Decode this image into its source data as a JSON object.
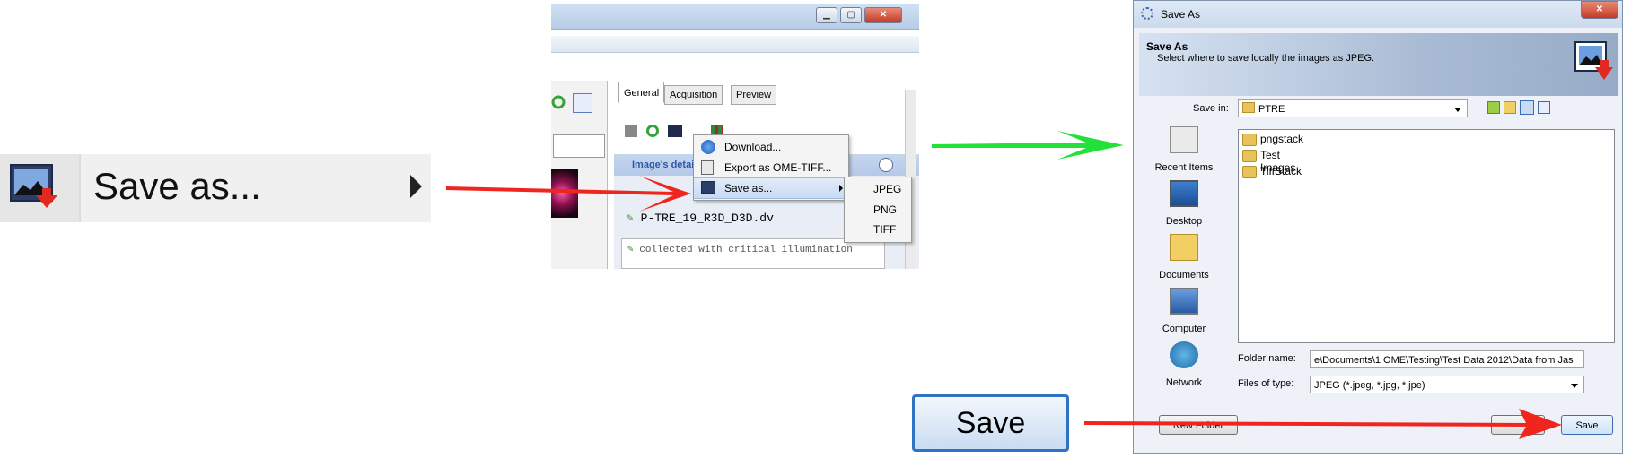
{
  "panel1": {
    "menu_item_label": "Save as...",
    "icon": "image-save-icon",
    "submenu_indicator": "triangle-right-icon"
  },
  "app_window": {
    "tabs": [
      "General",
      "Acquisition",
      "Preview"
    ],
    "context_menu": {
      "items": [
        {
          "label": "Download...",
          "icon": "download-icon"
        },
        {
          "label": "Export as OME-TIFF...",
          "icon": "export-icon"
        },
        {
          "label": "Save as...",
          "icon": "image-save-icon"
        }
      ]
    },
    "submenu": {
      "items": [
        "JPEG",
        "PNG",
        "TIFF"
      ]
    },
    "details_title": "Image's details",
    "filename": "P-TRE_19_R3D_D3D.dv",
    "description": "collected with critical illumination"
  },
  "save_dialog": {
    "title": "Save As",
    "header_title": "Save As",
    "header_subtitle": "Select where to save locally the images as JPEG.",
    "save_in_label": "Save in:",
    "save_in_value": "PTRE",
    "places": [
      "Recent Items",
      "Desktop",
      "Documents",
      "Computer",
      "Network"
    ],
    "files": [
      "pngstack",
      "Test Images",
      "TiffStack"
    ],
    "folder_name_label": "Folder name:",
    "folder_name_value": "e\\Documents\\1 OME\\Testing\\Test Data 2012\\Data from Jas",
    "files_of_type_label": "Files of type:",
    "files_of_type_value": "JPEG (*.jpeg, *.jpg, *.jpe)",
    "new_folder_label": "New Folder",
    "save_label": "Save"
  },
  "zoomed_save_button": {
    "label": "Save"
  },
  "colors": {
    "arrow_red": "#f0261e",
    "arrow_green": "#22e23a",
    "accent_blue": "#3b6db3"
  }
}
